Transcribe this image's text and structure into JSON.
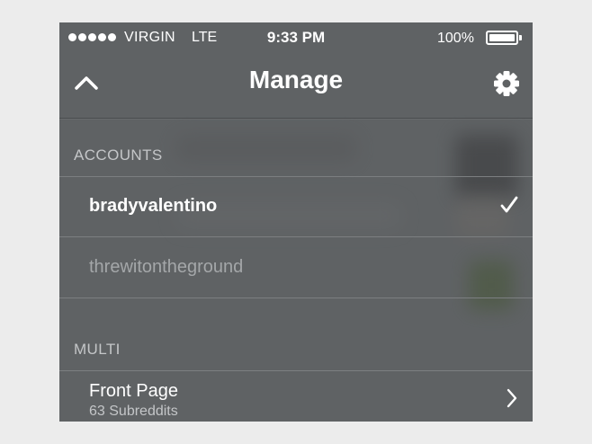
{
  "status_bar": {
    "carrier": "VIRGIN",
    "network": "LTE",
    "time": "9:33 PM",
    "battery_percent": "100%",
    "battery_level": 1.0
  },
  "navbar": {
    "title": "Manage",
    "back_icon": "chevron-up-icon",
    "settings_icon": "gear-icon"
  },
  "accounts": {
    "header": "ACCOUNTS",
    "items": [
      {
        "name": "bradyvalentino",
        "selected": true,
        "icon": "checkmark-icon"
      },
      {
        "name": "threwitontheground",
        "selected": false
      }
    ]
  },
  "multi": {
    "header": "MULTI",
    "items": [
      {
        "title": "Front Page",
        "subtitle": "63 Subreddits",
        "icon": "chevron-right-icon"
      }
    ]
  },
  "colors": {
    "background": "#5f6264",
    "text_primary": "#ffffff",
    "text_secondary": "#a4a7a9",
    "section_header": "#c4c6c8",
    "divider": "#7c7f81"
  }
}
